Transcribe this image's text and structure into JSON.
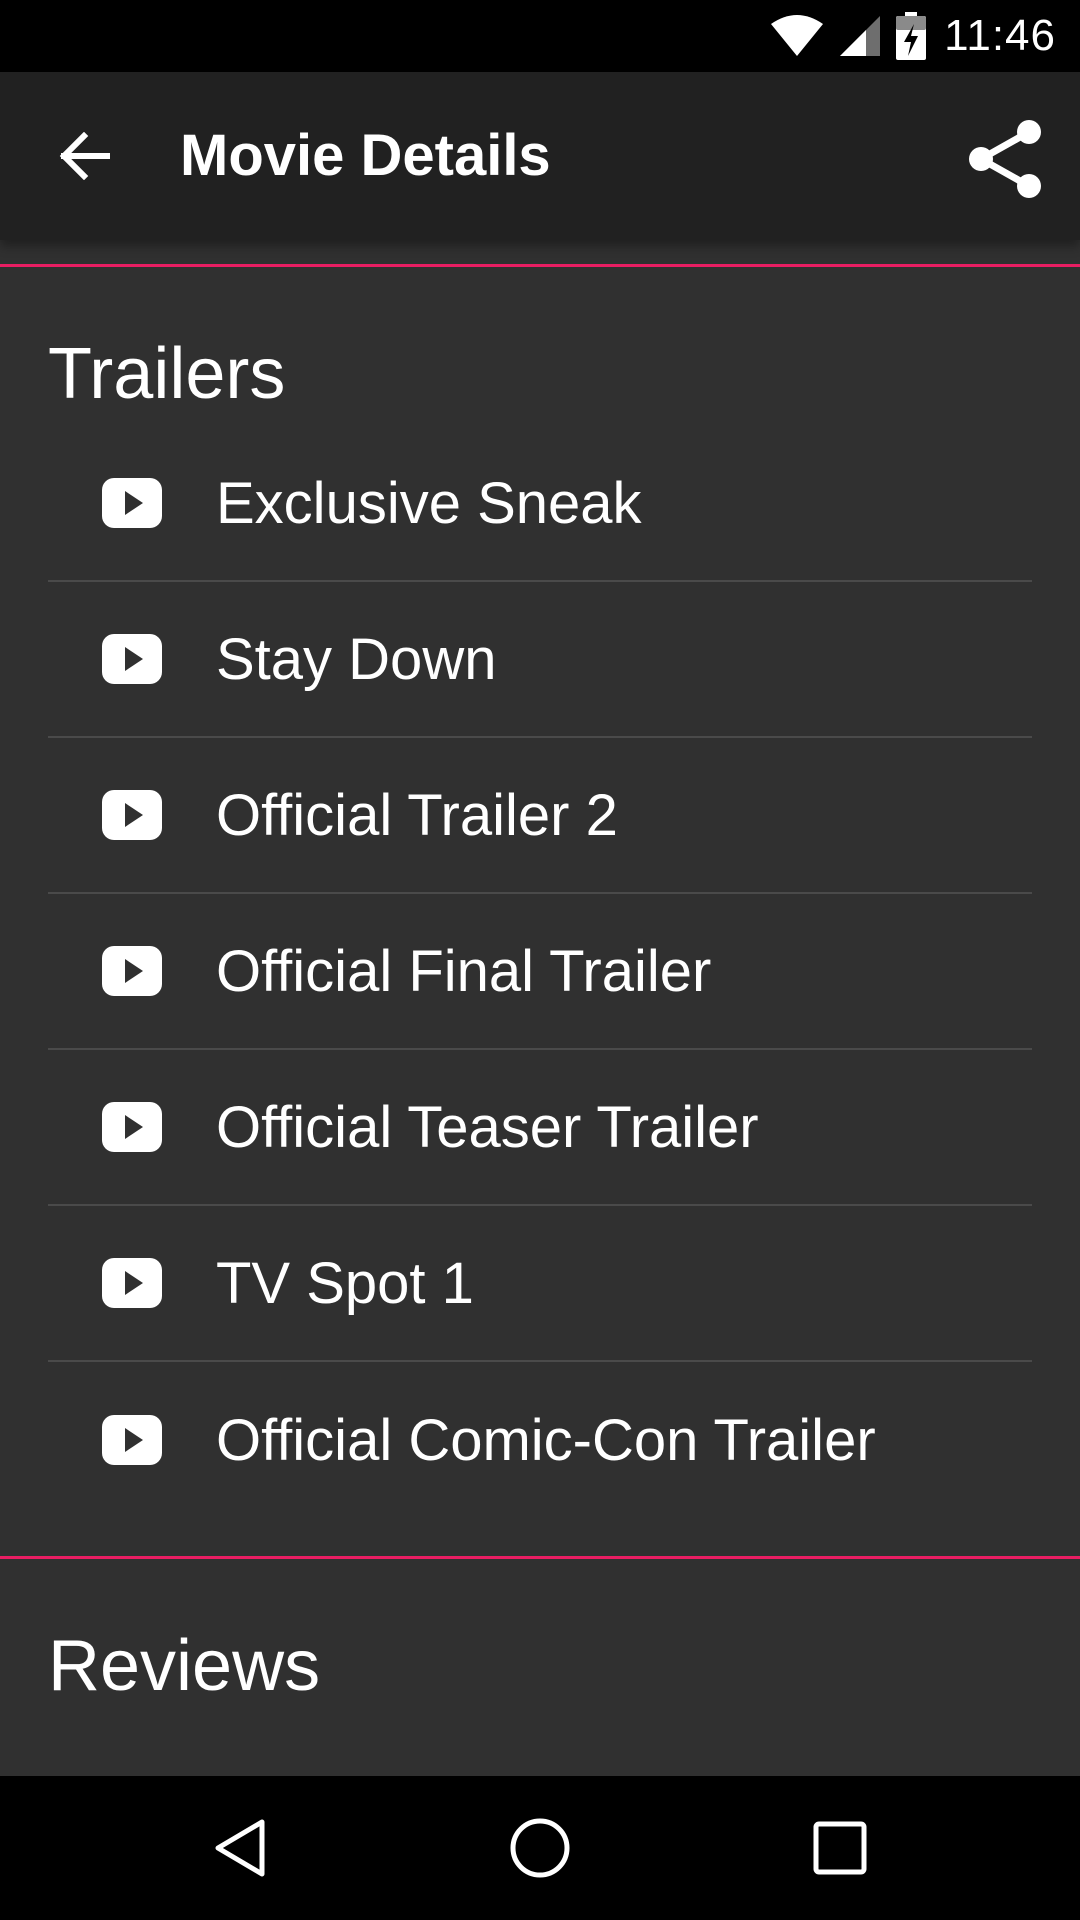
{
  "status_bar": {
    "time": "11:46",
    "icons": [
      "wifi-icon",
      "cell-signal-icon",
      "battery-charging-icon"
    ]
  },
  "app_bar": {
    "title": "Movie Details",
    "back_icon": "arrow-back-icon",
    "share_icon": "share-icon"
  },
  "colors": {
    "app_bar_bg": "#212121",
    "content_bg": "#303030",
    "accent": "#e91e63",
    "divider": "#4a4a4a"
  },
  "trailers": {
    "heading": "Trailers",
    "item_icon": "play-video-icon",
    "items": [
      {
        "label": "Exclusive Sneak"
      },
      {
        "label": "Stay Down"
      },
      {
        "label": "Official Trailer 2"
      },
      {
        "label": "Official Final Trailer"
      },
      {
        "label": "Official Teaser Trailer"
      },
      {
        "label": "TV Spot 1"
      },
      {
        "label": "Official Comic-Con Trailer"
      }
    ]
  },
  "reviews": {
    "heading": "Reviews"
  },
  "nav_bar": {
    "buttons": [
      "back-triangle-icon",
      "home-circle-icon",
      "recents-square-icon"
    ]
  }
}
